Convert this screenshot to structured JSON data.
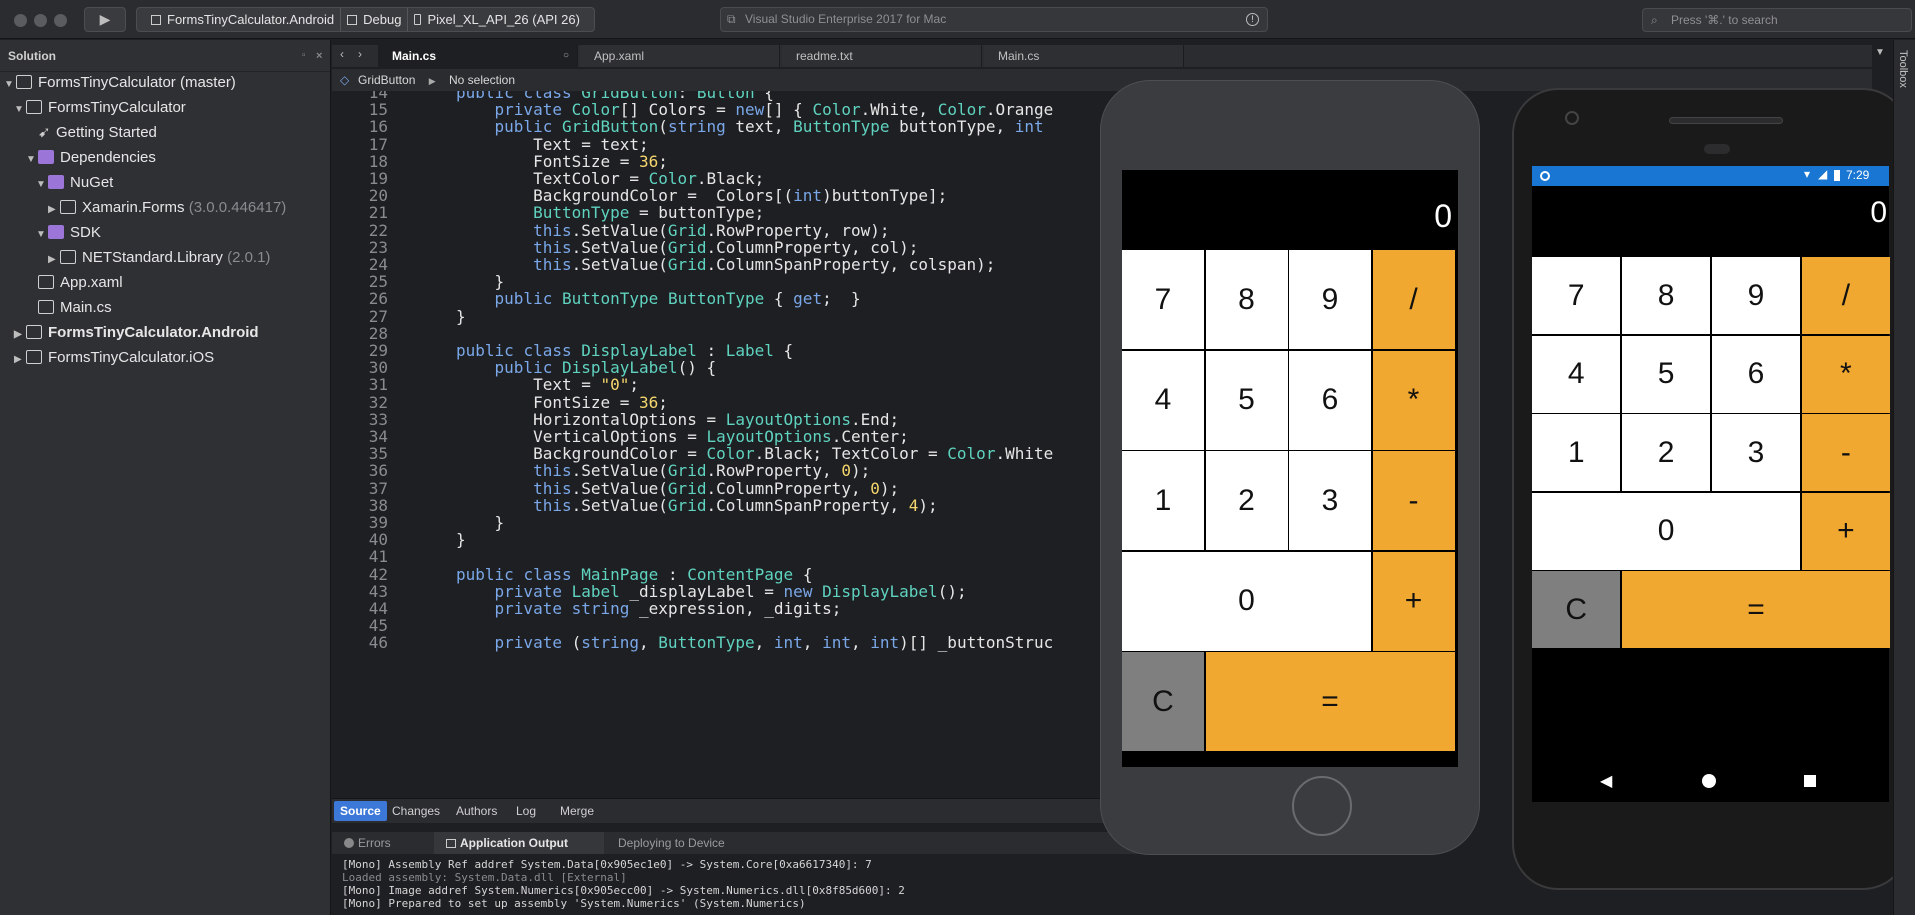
{
  "titlebar": {
    "project": "FormsTinyCalculator.Android",
    "config": "Debug",
    "device": "Pixel_XL_API_26 (API 26)",
    "status": "Visual Studio Enterprise 2017 for Mac",
    "search_placeholder": "Press '⌘.' to search"
  },
  "sidebar": {
    "title": "Solution",
    "items": [
      {
        "label": "FormsTinyCalculator (master)",
        "extra": ""
      },
      {
        "label": "FormsTinyCalculator",
        "extra": ""
      },
      {
        "label": "Getting Started",
        "extra": ""
      },
      {
        "label": "Dependencies",
        "extra": ""
      },
      {
        "label": "NuGet",
        "extra": ""
      },
      {
        "label": "Xamarin.Forms",
        "extra": "(3.0.0.446417)"
      },
      {
        "label": "SDK",
        "extra": ""
      },
      {
        "label": "NETStandard.Library",
        "extra": "(2.0.1)"
      },
      {
        "label": "App.xaml",
        "extra": ""
      },
      {
        "label": "Main.cs",
        "extra": ""
      },
      {
        "label": "FormsTinyCalculator.Android",
        "extra": ""
      },
      {
        "label": "FormsTinyCalculator.iOS",
        "extra": ""
      }
    ]
  },
  "tabs": [
    "Main.cs",
    "App.xaml",
    "readme.txt",
    "Main.cs"
  ],
  "breadcrumb": {
    "item": "GridButton",
    "selection": "No selection"
  },
  "editor": {
    "lines": [
      {
        "n": "14",
        "code": "public class GridButton: Button {"
      },
      {
        "n": "15",
        "code": "    private Color[] Colors = new[] { Color.White, Color.Orange"
      },
      {
        "n": "16",
        "code": "    public GridButton(string text, ButtonType buttonType, int"
      },
      {
        "n": "17",
        "code": "        Text = text;"
      },
      {
        "n": "18",
        "code": "        FontSize = 36;"
      },
      {
        "n": "19",
        "code": "        TextColor = Color.Black;"
      },
      {
        "n": "20",
        "code": "        BackgroundColor =  Colors[(int)buttonType];"
      },
      {
        "n": "21",
        "code": "        ButtonType = buttonType;"
      },
      {
        "n": "22",
        "code": "        this.SetValue(Grid.RowProperty, row);"
      },
      {
        "n": "23",
        "code": "        this.SetValue(Grid.ColumnProperty, col);"
      },
      {
        "n": "24",
        "code": "        this.SetValue(Grid.ColumnSpanProperty, colspan);"
      },
      {
        "n": "25",
        "code": "    }"
      },
      {
        "n": "26",
        "code": "    public ButtonType ButtonType { get;  }"
      },
      {
        "n": "27",
        "code": "}"
      },
      {
        "n": "28",
        "code": ""
      },
      {
        "n": "29",
        "code": "public class DisplayLabel : Label {"
      },
      {
        "n": "30",
        "code": "    public DisplayLabel() {"
      },
      {
        "n": "31",
        "code": "        Text = \"0\";"
      },
      {
        "n": "32",
        "code": "        FontSize = 36;"
      },
      {
        "n": "33",
        "code": "        HorizontalOptions = LayoutOptions.End;"
      },
      {
        "n": "34",
        "code": "        VerticalOptions = LayoutOptions.Center;"
      },
      {
        "n": "35",
        "code": "        BackgroundColor = Color.Black; TextColor = Color.White"
      },
      {
        "n": "36",
        "code": "        this.SetValue(Grid.RowProperty, 0);"
      },
      {
        "n": "37",
        "code": "        this.SetValue(Grid.ColumnProperty, 0);"
      },
      {
        "n": "38",
        "code": "        this.SetValue(Grid.ColumnSpanProperty, 4);"
      },
      {
        "n": "39",
        "code": "    }"
      },
      {
        "n": "40",
        "code": "}"
      },
      {
        "n": "41",
        "code": ""
      },
      {
        "n": "42",
        "code": "public class MainPage : ContentPage {"
      },
      {
        "n": "43",
        "code": "    private Label _displayLabel = new DisplayLabel();"
      },
      {
        "n": "44",
        "code": "    private string _expression, _digits;"
      },
      {
        "n": "45",
        "code": ""
      },
      {
        "n": "46",
        "code": "    private (string, ButtonType, int, int, int)[] _buttonStruc"
      }
    ]
  },
  "bottom_tabs": [
    "Source",
    "Changes",
    "Authors",
    "Log",
    "Merge"
  ],
  "pad_tabs": [
    "Errors",
    "Application Output",
    "Deploying to Device"
  ],
  "output_lines": [
    "[Mono] Assembly Ref addref System.Data[0x905ec1e0] -> System.Core[0xa6617340]: 7",
    "Loaded assembly: System.Data.dll [External]",
    "[Mono] Image addref System.Numerics[0x905ecc00] -> System.Numerics.dll[0x8f85d600]: 2",
    "[Mono] Prepared to set up assembly 'System.Numerics' (System.Numerics)"
  ],
  "calculator": {
    "display": "0",
    "buttons": [
      "7",
      "8",
      "9",
      "/",
      "4",
      "5",
      "6",
      "*",
      "1",
      "2",
      "3",
      "-",
      "0",
      "+",
      "C",
      "="
    ]
  },
  "android": {
    "time": "7:29"
  },
  "toolbox_label": "Toolbox"
}
